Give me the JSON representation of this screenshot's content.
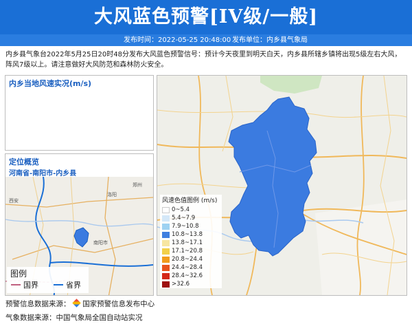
{
  "banner": {
    "title": "大风蓝色预警[IV级/一般]"
  },
  "meta": {
    "publish_time_label": "发布时间：",
    "publish_time": "2022-05-25 20:48:00",
    "publisher_label": "发布单位：",
    "publisher": "内乡县气象局"
  },
  "description": "内乡县气象台2022年5月25日20时48分发布大风蓝色预警信号：预计今天夜里到明天白天，内乡县所辖乡镇将出现5级左右大风，阵风7级以上。请注意做好大风防范和森林防火安全。",
  "wind_panel": {
    "title": "内乡当地风速实况(m/s)"
  },
  "location_panel": {
    "title": "定位概览",
    "path": "河南省-南阳市-内乡县",
    "map_labels": [
      "西安",
      "南阳市",
      "洛阳",
      "郑州"
    ],
    "legend_title": "图例",
    "legend_items": [
      {
        "label": "国界",
        "color": "#c06080"
      },
      {
        "label": "省界",
        "color": "#1a6fd6"
      }
    ]
  },
  "wind_legend": {
    "title": "风速色值图例 (m/s)",
    "items": [
      {
        "label": "0~5.4",
        "color": "#ffffff"
      },
      {
        "label": "5.4~7.9",
        "color": "#d4e8f8"
      },
      {
        "label": "7.9~10.8",
        "color": "#9ed2f2"
      },
      {
        "label": "10.8~13.8",
        "color": "#3f7fe0"
      },
      {
        "label": "13.8~17.1",
        "color": "#f7e6a0"
      },
      {
        "label": "17.1~20.8",
        "color": "#f2d04a"
      },
      {
        "label": "20.8~24.4",
        "color": "#f29c1c"
      },
      {
        "label": "24.4~28.4",
        "color": "#e8541c"
      },
      {
        "label": "28.4~32.6",
        "color": "#d42818"
      },
      {
        "label": ">32.6",
        "color": "#9e1010"
      }
    ]
  },
  "footer": {
    "source1_label": "预警信息数据来源：",
    "source1": "国家预警信息发布中心",
    "source2_label": "气象数据来源：",
    "source2": "中国气象局全国自动站实况"
  },
  "colors": {
    "accent": "#1a6fd6",
    "region_fill": "#3b7be0"
  }
}
